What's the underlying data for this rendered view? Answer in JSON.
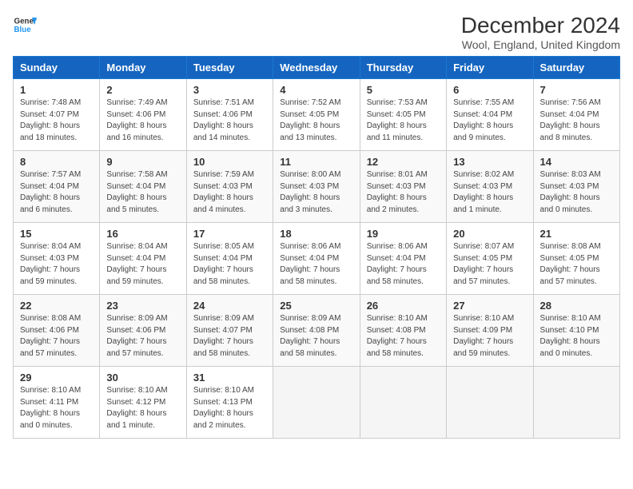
{
  "header": {
    "logo_line1": "General",
    "logo_line2": "Blue",
    "title": "December 2024",
    "subtitle": "Wool, England, United Kingdom"
  },
  "weekdays": [
    "Sunday",
    "Monday",
    "Tuesday",
    "Wednesday",
    "Thursday",
    "Friday",
    "Saturday"
  ],
  "weeks": [
    [
      {
        "day": "1",
        "info": "Sunrise: 7:48 AM\nSunset: 4:07 PM\nDaylight: 8 hours\nand 18 minutes."
      },
      {
        "day": "2",
        "info": "Sunrise: 7:49 AM\nSunset: 4:06 PM\nDaylight: 8 hours\nand 16 minutes."
      },
      {
        "day": "3",
        "info": "Sunrise: 7:51 AM\nSunset: 4:06 PM\nDaylight: 8 hours\nand 14 minutes."
      },
      {
        "day": "4",
        "info": "Sunrise: 7:52 AM\nSunset: 4:05 PM\nDaylight: 8 hours\nand 13 minutes."
      },
      {
        "day": "5",
        "info": "Sunrise: 7:53 AM\nSunset: 4:05 PM\nDaylight: 8 hours\nand 11 minutes."
      },
      {
        "day": "6",
        "info": "Sunrise: 7:55 AM\nSunset: 4:04 PM\nDaylight: 8 hours\nand 9 minutes."
      },
      {
        "day": "7",
        "info": "Sunrise: 7:56 AM\nSunset: 4:04 PM\nDaylight: 8 hours\nand 8 minutes."
      }
    ],
    [
      {
        "day": "8",
        "info": "Sunrise: 7:57 AM\nSunset: 4:04 PM\nDaylight: 8 hours\nand 6 minutes."
      },
      {
        "day": "9",
        "info": "Sunrise: 7:58 AM\nSunset: 4:04 PM\nDaylight: 8 hours\nand 5 minutes."
      },
      {
        "day": "10",
        "info": "Sunrise: 7:59 AM\nSunset: 4:03 PM\nDaylight: 8 hours\nand 4 minutes."
      },
      {
        "day": "11",
        "info": "Sunrise: 8:00 AM\nSunset: 4:03 PM\nDaylight: 8 hours\nand 3 minutes."
      },
      {
        "day": "12",
        "info": "Sunrise: 8:01 AM\nSunset: 4:03 PM\nDaylight: 8 hours\nand 2 minutes."
      },
      {
        "day": "13",
        "info": "Sunrise: 8:02 AM\nSunset: 4:03 PM\nDaylight: 8 hours\nand 1 minute."
      },
      {
        "day": "14",
        "info": "Sunrise: 8:03 AM\nSunset: 4:03 PM\nDaylight: 8 hours\nand 0 minutes."
      }
    ],
    [
      {
        "day": "15",
        "info": "Sunrise: 8:04 AM\nSunset: 4:03 PM\nDaylight: 7 hours\nand 59 minutes."
      },
      {
        "day": "16",
        "info": "Sunrise: 8:04 AM\nSunset: 4:04 PM\nDaylight: 7 hours\nand 59 minutes."
      },
      {
        "day": "17",
        "info": "Sunrise: 8:05 AM\nSunset: 4:04 PM\nDaylight: 7 hours\nand 58 minutes."
      },
      {
        "day": "18",
        "info": "Sunrise: 8:06 AM\nSunset: 4:04 PM\nDaylight: 7 hours\nand 58 minutes."
      },
      {
        "day": "19",
        "info": "Sunrise: 8:06 AM\nSunset: 4:04 PM\nDaylight: 7 hours\nand 58 minutes."
      },
      {
        "day": "20",
        "info": "Sunrise: 8:07 AM\nSunset: 4:05 PM\nDaylight: 7 hours\nand 57 minutes."
      },
      {
        "day": "21",
        "info": "Sunrise: 8:08 AM\nSunset: 4:05 PM\nDaylight: 7 hours\nand 57 minutes."
      }
    ],
    [
      {
        "day": "22",
        "info": "Sunrise: 8:08 AM\nSunset: 4:06 PM\nDaylight: 7 hours\nand 57 minutes."
      },
      {
        "day": "23",
        "info": "Sunrise: 8:09 AM\nSunset: 4:06 PM\nDaylight: 7 hours\nand 57 minutes."
      },
      {
        "day": "24",
        "info": "Sunrise: 8:09 AM\nSunset: 4:07 PM\nDaylight: 7 hours\nand 58 minutes."
      },
      {
        "day": "25",
        "info": "Sunrise: 8:09 AM\nSunset: 4:08 PM\nDaylight: 7 hours\nand 58 minutes."
      },
      {
        "day": "26",
        "info": "Sunrise: 8:10 AM\nSunset: 4:08 PM\nDaylight: 7 hours\nand 58 minutes."
      },
      {
        "day": "27",
        "info": "Sunrise: 8:10 AM\nSunset: 4:09 PM\nDaylight: 7 hours\nand 59 minutes."
      },
      {
        "day": "28",
        "info": "Sunrise: 8:10 AM\nSunset: 4:10 PM\nDaylight: 8 hours\nand 0 minutes."
      }
    ],
    [
      {
        "day": "29",
        "info": "Sunrise: 8:10 AM\nSunset: 4:11 PM\nDaylight: 8 hours\nand 0 minutes."
      },
      {
        "day": "30",
        "info": "Sunrise: 8:10 AM\nSunset: 4:12 PM\nDaylight: 8 hours\nand 1 minute."
      },
      {
        "day": "31",
        "info": "Sunrise: 8:10 AM\nSunset: 4:13 PM\nDaylight: 8 hours\nand 2 minutes."
      },
      {
        "day": "",
        "info": ""
      },
      {
        "day": "",
        "info": ""
      },
      {
        "day": "",
        "info": ""
      },
      {
        "day": "",
        "info": ""
      }
    ]
  ]
}
